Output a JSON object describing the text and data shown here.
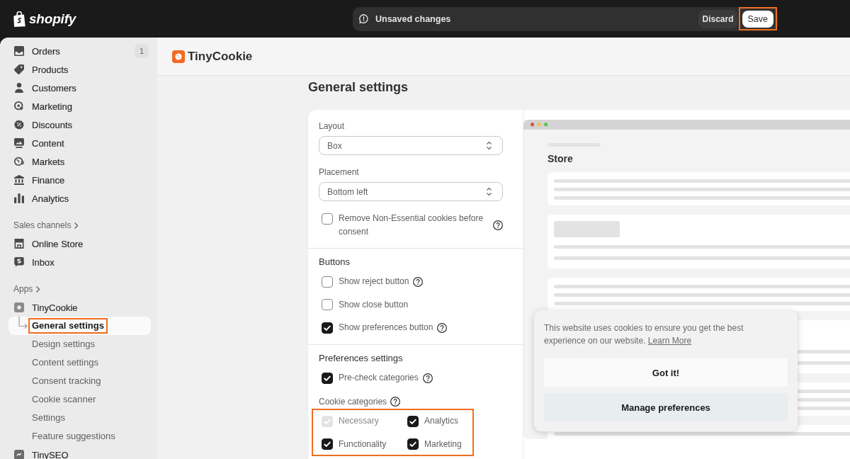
{
  "topbar": {
    "logo": "shopify",
    "notice": "Unsaved changes",
    "discard": "Discard",
    "save": {
      "label": "Save",
      "highlighted": true
    }
  },
  "sidebar": {
    "items": [
      {
        "label": "Orders",
        "badge": "1",
        "selected": false
      },
      {
        "label": "Products",
        "selected": false
      },
      {
        "label": "Customers",
        "selected": false
      },
      {
        "label": "Marketing",
        "selected": false
      },
      {
        "label": "Discounts",
        "selected": false
      },
      {
        "label": "Content",
        "selected": false
      },
      {
        "label": "Markets",
        "selected": false
      },
      {
        "label": "Finance",
        "selected": false
      },
      {
        "label": "Analytics",
        "selected": false
      }
    ],
    "sections": [
      {
        "title": "Sales channels",
        "items": [
          {
            "label": "Online Store",
            "selected": false
          },
          {
            "label": "Inbox",
            "selected": false
          }
        ]
      },
      {
        "title": "Apps",
        "items": [
          {
            "label": "TinyCookie",
            "selected": false,
            "children": [
              {
                "label": "General settings",
                "selected": true,
                "highlighted": true
              },
              {
                "label": "Design settings",
                "selected": false,
                "highlighted": false
              },
              {
                "label": "Content settings",
                "selected": false,
                "highlighted": false
              },
              {
                "label": "Consent tracking",
                "selected": false,
                "highlighted": false
              },
              {
                "label": "Cookie scanner",
                "selected": false,
                "highlighted": false
              },
              {
                "label": "Settings",
                "selected": false,
                "highlighted": false
              },
              {
                "label": "Feature suggestions",
                "selected": false,
                "highlighted": false
              }
            ]
          },
          {
            "label": "TinySEO",
            "selected": false
          }
        ]
      }
    ]
  },
  "app": {
    "title": "TinyCookie"
  },
  "page_title": "General settings",
  "form": {
    "sections": [
      {
        "fields": [
          {
            "kind": "select",
            "label": "Layout",
            "value": "Box"
          },
          {
            "kind": "select",
            "label": "Placement",
            "value": "Bottom left"
          },
          {
            "kind": "checkbox",
            "label": "Remove Non-Essential cookies before consent",
            "checked": false,
            "help": true
          }
        ]
      },
      {
        "title": "Buttons",
        "fields": [
          {
            "kind": "checkbox",
            "label": "Show reject button",
            "checked": false,
            "help": true
          },
          {
            "kind": "checkbox",
            "label": "Show close button",
            "checked": false
          },
          {
            "kind": "checkbox",
            "label": "Show preferences button",
            "checked": true,
            "help": true
          }
        ]
      },
      {
        "title": "Preferences settings",
        "fields": [
          {
            "kind": "checkbox",
            "label": "Pre-check categories",
            "checked": true,
            "help": true
          },
          {
            "kind": "group",
            "label": "Cookie categories",
            "help": true,
            "highlighted": true,
            "options": [
              {
                "label": "Necessary",
                "checked": true,
                "disabled": true
              },
              {
                "label": "Analytics",
                "checked": true,
                "disabled": false
              },
              {
                "label": "Functionality",
                "checked": true,
                "disabled": false
              },
              {
                "label": "Marketing",
                "checked": true,
                "disabled": false
              }
            ]
          }
        ]
      }
    ]
  },
  "preview": {
    "heading": "Store",
    "banner": {
      "text": "This website uses cookies to ensure you get the best experience on our website.",
      "link": "Learn More",
      "buttons": [
        {
          "label": "Got it!",
          "kind": "primary"
        },
        {
          "label": "Manage preferences",
          "kind": "secondary"
        }
      ]
    }
  }
}
